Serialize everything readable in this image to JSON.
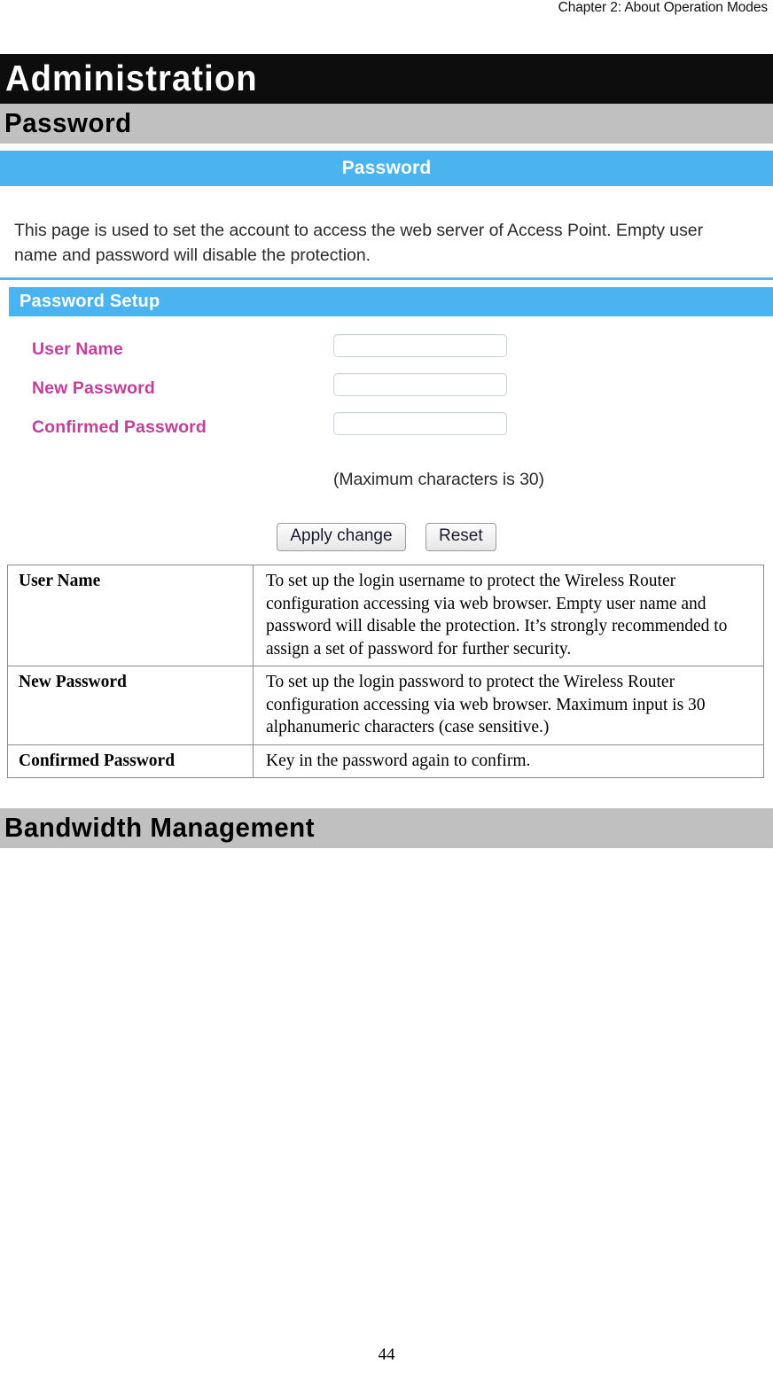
{
  "running_header": "Chapter 2: About Operation Modes",
  "chapter_banner": {
    "title": "Administration",
    "section_password": "Password",
    "section_bandwidth": "Bandwidth Management"
  },
  "screenshot": {
    "title_bar": "Password",
    "intro_text": "This page is used to set the account to access the web server of Access Point. Empty user name and password will disable the protection.",
    "section_bar": "Password Setup",
    "fields": [
      {
        "label": "User Name",
        "value": "",
        "placeholder": ""
      },
      {
        "label": "New Password",
        "value": "",
        "placeholder": ""
      },
      {
        "label": "Confirmed Password",
        "value": "",
        "placeholder": ""
      }
    ],
    "max_chars_note": "(Maximum characters is 30)",
    "buttons": {
      "apply": "Apply change",
      "reset": "Reset"
    },
    "colors": {
      "header_blue": "#4bb4f0",
      "label_magenta": "#c0409a",
      "banner_black": "#0d0d0d",
      "banner_gray": "#c0c0c0"
    }
  },
  "description_table": {
    "rows": [
      {
        "key": "User Name",
        "value": "To set up the login username to protect the Wireless Router configuration accessing via web browser. Empty user name and password will disable the protection. It’s strongly recommended to assign a set of password for further security."
      },
      {
        "key": "New Password",
        "value": "To set up the login password to protect the Wireless Router configuration accessing via web browser. Maximum input is 30 alphanumeric characters (case sensitive.)"
      },
      {
        "key": "Confirmed Password",
        "value": "Key in the password again to confirm."
      }
    ]
  },
  "page_number": "44"
}
